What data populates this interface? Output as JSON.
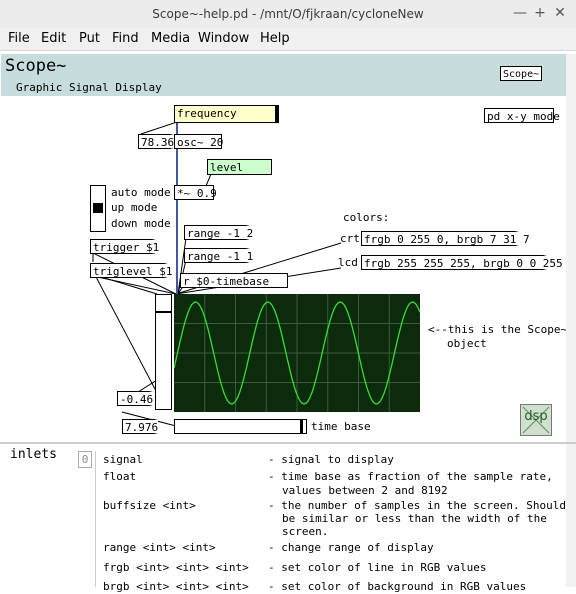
{
  "window": {
    "title": "Scope~-help.pd  - /mnt/O/fjkraan/cycloneNew",
    "minimize": "—",
    "maximize": "+",
    "close": "✕"
  },
  "menu": [
    "File",
    "Edit",
    "Put",
    "Find",
    "Media",
    "Window",
    "Help"
  ],
  "header": {
    "title": "Scope~",
    "subtitle": "Graphic Signal Display",
    "badge": "Scope~"
  },
  "patch": {
    "pd_xy": "pd x-y mode",
    "frequency": "frequency",
    "freq_value": "78.36",
    "osc": "osc~ 20",
    "level": "level",
    "mul": "*~ 0.9",
    "modes": [
      "auto mode",
      "up mode",
      "down mode"
    ],
    "trigger": "trigger $1",
    "triglevel": "triglevel $1",
    "range1": "range -1 2",
    "range2": "range -1 1",
    "timebase_r": "r $0-timebase",
    "colors_label": "colors:",
    "crt_label": "crt",
    "crt_msg": "frgb 0 255 0, brgb 7 31 7",
    "lcd_label": "lcd",
    "lcd_msg": "frgb 255 255 255, brgb 0 0 255",
    "scope_note_1": "<--this is the Scope~",
    "scope_note_2": "object",
    "slider_value": "-0.46",
    "timebase_value": "7.976",
    "timebase_label": "time base",
    "dsp": "dsp",
    "slider_level": 0.86,
    "timebase_level": 0.98
  },
  "inlets": {
    "heading": "inlets",
    "index": "0",
    "rows": [
      {
        "name": "signal",
        "desc": "- signal to display"
      },
      {
        "name": "float",
        "desc": "- time base as fraction of the sample rate,",
        "desc2": "values between 2 and 8192"
      },
      {
        "name": "buffsize <int>",
        "desc": "- the number of samples in the screen. Should",
        "desc2": "be similar or less than the width of the",
        "desc3": "screen."
      },
      {
        "name": "range <int> <int>",
        "desc": "- change range of display"
      },
      {
        "name": "frgb <int> <int> <int>",
        "desc": "- set color of line in RGB values"
      },
      {
        "name": "brgb <int> <int> <int>",
        "desc": "- set color of background in RGB values"
      }
    ]
  },
  "colors": {
    "header_bg": "#c7dcdc",
    "scope_bg": "#0c2a0c",
    "scope_line": "#33dd33",
    "comment_bg": "#ffffcc",
    "level_bg": "#ccffcc"
  }
}
